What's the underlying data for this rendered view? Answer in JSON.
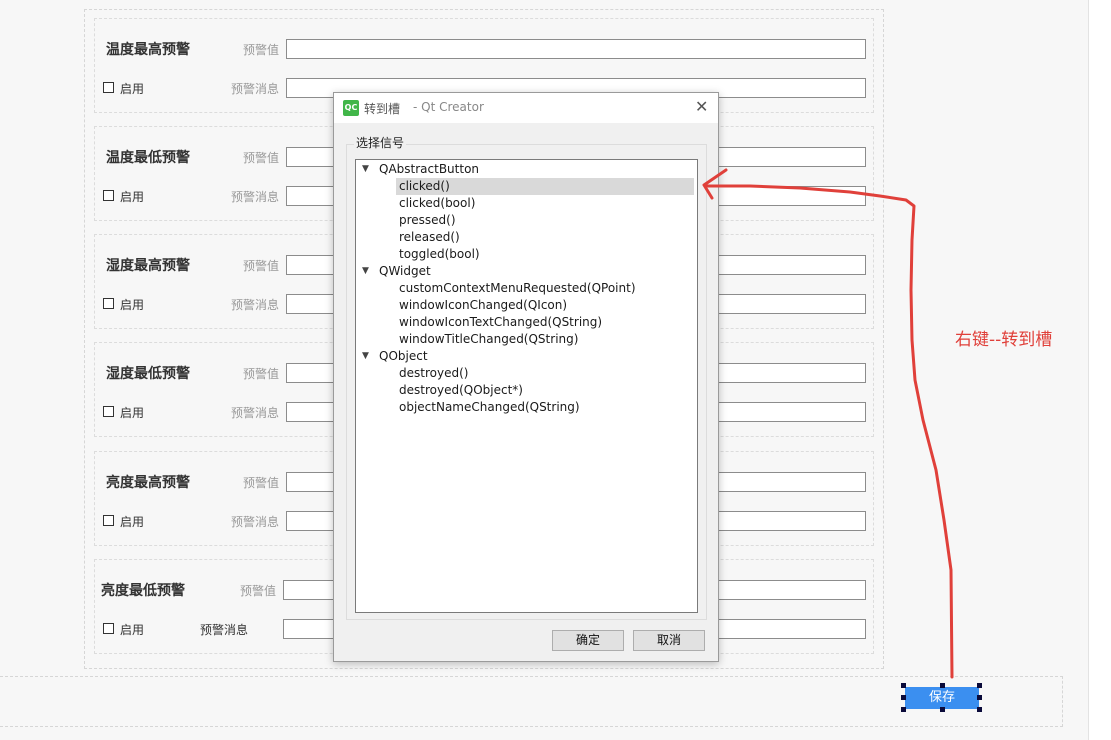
{
  "form": {
    "groups": [
      {
        "title": "温度最高预警",
        "threshold_label": "预警值",
        "message_label": "预警消息",
        "enable_label": "启用",
        "threshold_value": "",
        "message_value": ""
      },
      {
        "title": "温度最低预警",
        "threshold_label": "预警值",
        "message_label": "预警消息",
        "enable_label": "启用",
        "threshold_value": "",
        "message_value": ""
      },
      {
        "title": "湿度最高预警",
        "threshold_label": "预警值",
        "message_label": "预警消息",
        "enable_label": "启用",
        "threshold_value": "",
        "message_value": ""
      },
      {
        "title": "湿度最低预警",
        "threshold_label": "预警值",
        "message_label": "预警消息",
        "enable_label": "启用",
        "threshold_value": "",
        "message_value": ""
      },
      {
        "title": "亮度最高预警",
        "threshold_label": "预警值",
        "message_label": "预警消息",
        "enable_label": "启用",
        "threshold_value": "",
        "message_value": ""
      },
      {
        "title": "亮度最低预警",
        "threshold_label": "预警值",
        "message_label": "预警消息",
        "enable_label": "启用",
        "threshold_value": "",
        "message_value": ""
      }
    ],
    "save_label": "保存"
  },
  "dialog": {
    "icon_text": "QC",
    "title_prefix": "转到槽",
    "title_suffix": "- Qt Creator",
    "close_glyph": "✕",
    "group_title": "选择信号",
    "tree": [
      {
        "text": "QAbstractButton",
        "kind": "class"
      },
      {
        "text": "clicked()",
        "kind": "signal",
        "selected": true
      },
      {
        "text": "clicked(bool)",
        "kind": "signal"
      },
      {
        "text": "pressed()",
        "kind": "signal"
      },
      {
        "text": "released()",
        "kind": "signal"
      },
      {
        "text": "toggled(bool)",
        "kind": "signal"
      },
      {
        "text": "QWidget",
        "kind": "class"
      },
      {
        "text": "customContextMenuRequested(QPoint)",
        "kind": "signal"
      },
      {
        "text": "windowIconChanged(QIcon)",
        "kind": "signal"
      },
      {
        "text": "windowIconTextChanged(QString)",
        "kind": "signal"
      },
      {
        "text": "windowTitleChanged(QString)",
        "kind": "signal"
      },
      {
        "text": "QObject",
        "kind": "class"
      },
      {
        "text": "destroyed()",
        "kind": "signal"
      },
      {
        "text": "destroyed(QObject*)",
        "kind": "signal"
      },
      {
        "text": "objectNameChanged(QString)",
        "kind": "signal"
      }
    ],
    "ok_label": "确定",
    "cancel_label": "取消"
  },
  "annotation": {
    "text": "右键--转到槽",
    "color": "#e0403a"
  },
  "colors": {
    "accent": "#3b8ff0",
    "selection": "#d9d9d9",
    "qc_green": "#41b649"
  },
  "icons": {
    "dialog_icon": "qt-creator-icon",
    "close": "close-icon",
    "expand": "chevron-down-icon"
  }
}
